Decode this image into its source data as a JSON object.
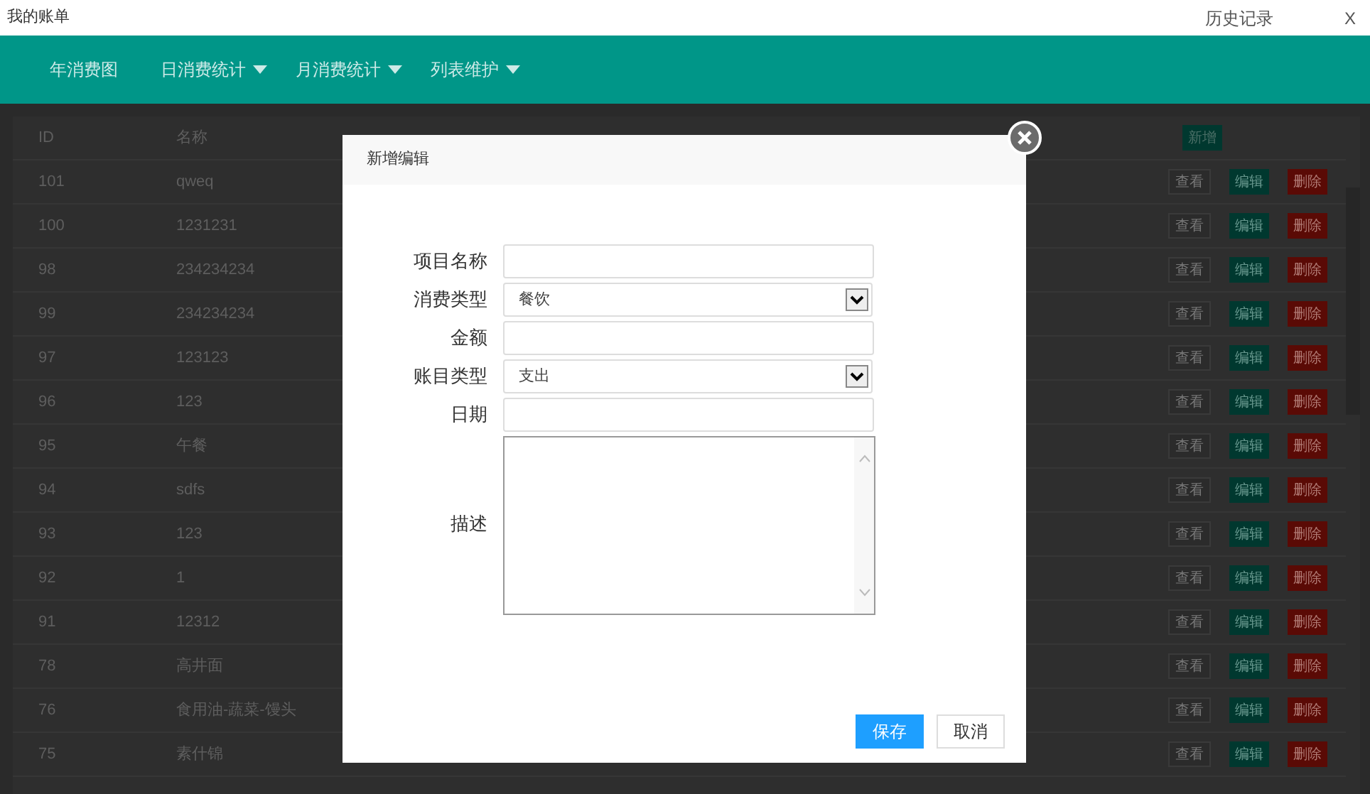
{
  "window": {
    "title": "我的账单",
    "history_link": "历史记录",
    "close": "X"
  },
  "nav": [
    {
      "label": "年消费图",
      "dropdown": false
    },
    {
      "label": "日消费统计",
      "dropdown": true
    },
    {
      "label": "月消费统计",
      "dropdown": true
    },
    {
      "label": "列表维护",
      "dropdown": true
    }
  ],
  "table": {
    "columns": [
      "ID",
      "名称"
    ],
    "add_button": "新增",
    "rows": [
      {
        "id": "101",
        "name": "qweq",
        "actions": [
          "查看",
          "编辑",
          "删除"
        ]
      },
      {
        "id": "100",
        "name": "1231231",
        "actions": [
          "查看",
          "编辑",
          "删除"
        ]
      },
      {
        "id": "98",
        "name": "234234234",
        "actions": [
          "查看",
          "编辑",
          "删除"
        ]
      },
      {
        "id": "99",
        "name": "234234234",
        "actions": [
          "查看",
          "编辑",
          "删除"
        ]
      },
      {
        "id": "97",
        "name": "123123",
        "actions": [
          "查看",
          "编辑",
          "删除"
        ]
      },
      {
        "id": "96",
        "name": "123",
        "actions": [
          "查看",
          "编辑",
          "删除"
        ]
      },
      {
        "id": "95",
        "name": "午餐",
        "actions": [
          "查看",
          "编辑",
          "删除"
        ]
      },
      {
        "id": "94",
        "name": "sdfs",
        "actions": [
          "查看",
          "编辑",
          "删除"
        ]
      },
      {
        "id": "93",
        "name": "123",
        "actions": [
          "查看",
          "编辑",
          "删除"
        ]
      },
      {
        "id": "92",
        "name": "1",
        "actions": [
          "查看",
          "编辑",
          "删除"
        ]
      },
      {
        "id": "91",
        "name": "12312",
        "actions": [
          "查看",
          "编辑",
          "删除"
        ]
      },
      {
        "id": "78",
        "name": "高井面",
        "actions": [
          "查看",
          "编辑",
          "删除"
        ]
      },
      {
        "id": "76",
        "name": "食用油-蔬菜-馒头",
        "actions": [
          "查看",
          "编辑",
          "删除"
        ]
      },
      {
        "id": "75",
        "name": "素什锦",
        "actions": [
          "查看",
          "编辑",
          "删除"
        ]
      }
    ]
  },
  "dialog": {
    "title": "新增编辑",
    "fields": [
      {
        "kind": "text",
        "label": "项目名称"
      },
      {
        "kind": "select",
        "label": "消费类型",
        "value": "餐饮"
      },
      {
        "kind": "text",
        "label": "金额"
      },
      {
        "kind": "select",
        "label": "账目类型",
        "value": "支出"
      },
      {
        "kind": "text",
        "label": "日期"
      },
      {
        "kind": "textarea",
        "label": "描述"
      }
    ],
    "buttons": [
      {
        "label": "保存",
        "primary": true
      },
      {
        "label": "取消",
        "primary": false
      }
    ]
  }
}
